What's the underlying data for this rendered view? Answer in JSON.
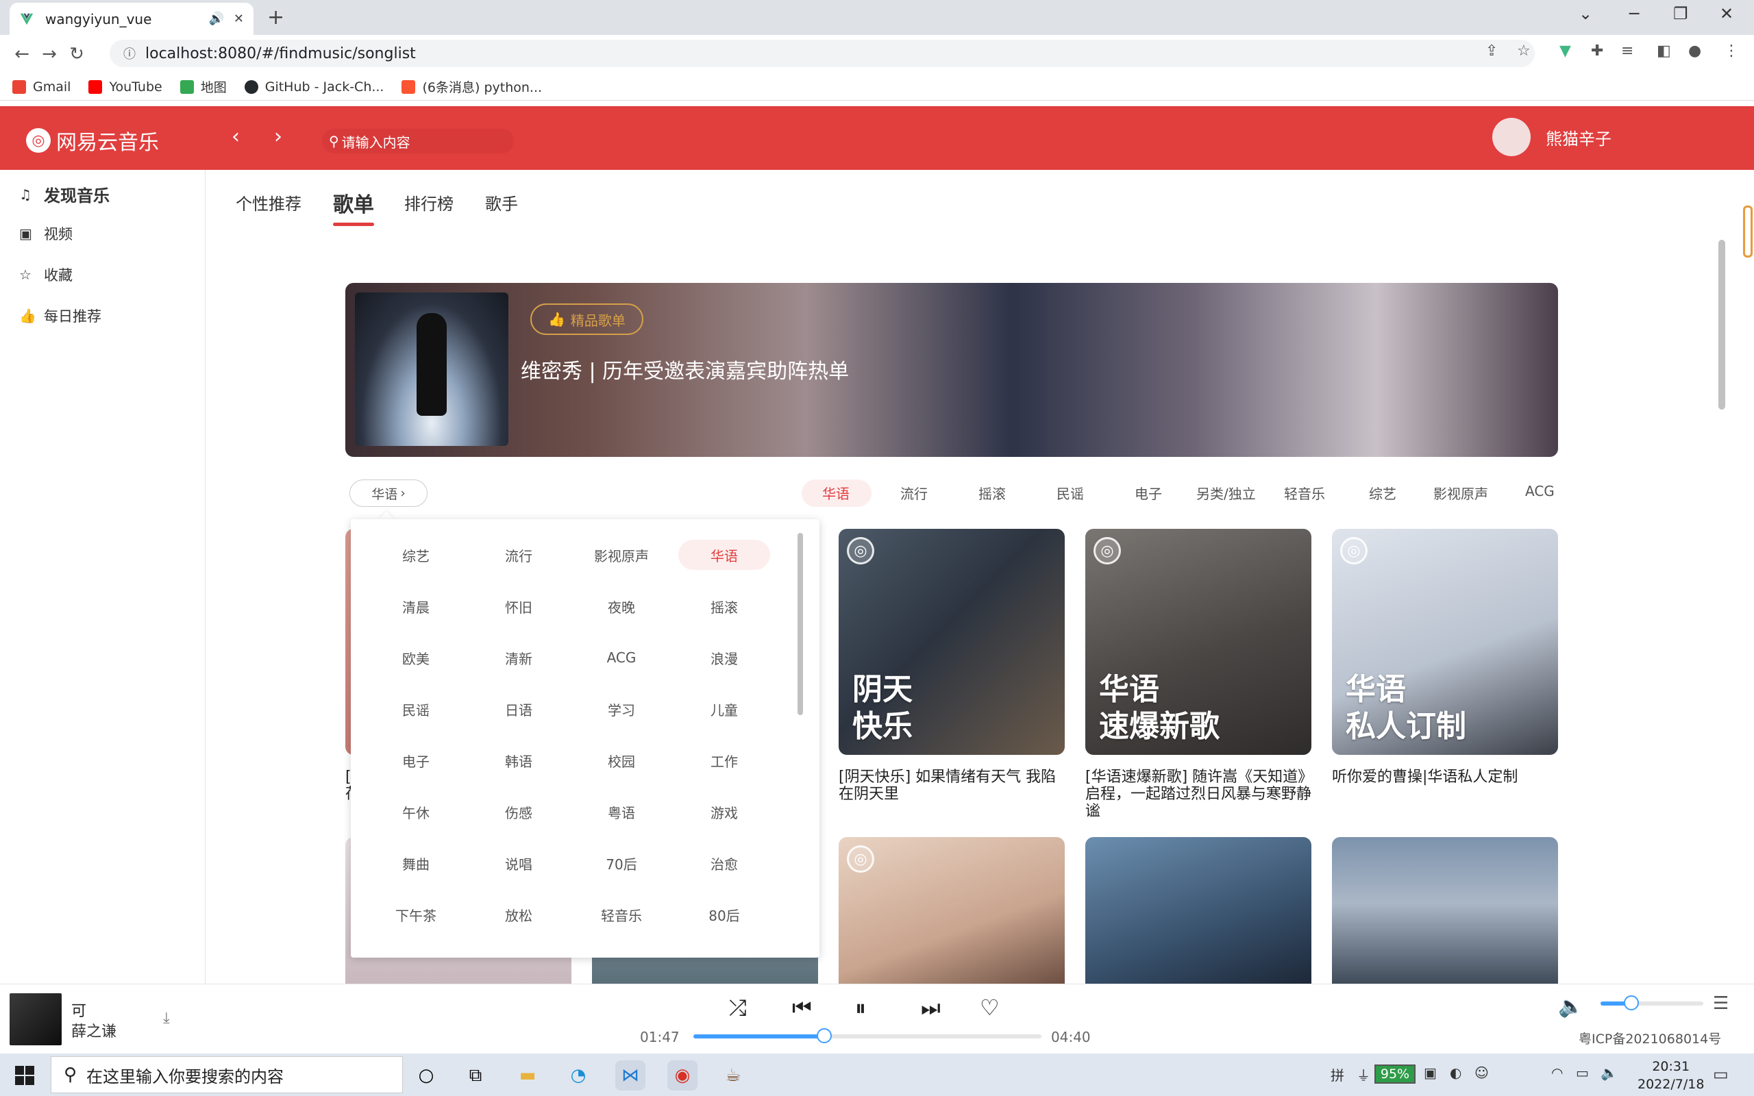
{
  "browser": {
    "tab_title": "wangyiyun_vue",
    "url": "localhost:8080/#/findmusic/songlist",
    "bookmarks": [
      {
        "label": "Gmail",
        "color": "#ea4335"
      },
      {
        "label": "YouTube",
        "color": "#ff0000"
      },
      {
        "label": "地图",
        "color": "#34a853"
      },
      {
        "label": "GitHub - Jack-Ch...",
        "color": "#24292e"
      },
      {
        "label": "(6条消息) python...",
        "color": "#fc5531"
      }
    ]
  },
  "app": {
    "logo_text": "网易云音乐",
    "search_placeholder": "请输入内容",
    "username": "熊猫辛子",
    "brand_color": "#e13e3e"
  },
  "sidebar": {
    "items": [
      {
        "label": "发现音乐",
        "icon": "music-note-icon"
      },
      {
        "label": "视频",
        "icon": "video-icon"
      },
      {
        "label": "收藏",
        "icon": "star-icon"
      },
      {
        "label": "每日推荐",
        "icon": "thumbs-up-icon"
      }
    ]
  },
  "tabs": [
    "个性推荐",
    "歌单",
    "排行榜",
    "歌手"
  ],
  "banner": {
    "tag": "精品歌单",
    "title": "维密秀 | 历年受邀表演嘉宾助阵热单"
  },
  "category_button": "华语",
  "categories": [
    "华语",
    "流行",
    "摇滚",
    "民谣",
    "电子",
    "另类/独立",
    "轻音乐",
    "综艺",
    "影视原声",
    "ACG"
  ],
  "popup": {
    "items": [
      "综艺",
      "流行",
      "影视原声",
      "华语",
      "清晨",
      "怀旧",
      "夜晚",
      "摇滚",
      "欧美",
      "清新",
      "ACG",
      "浪漫",
      "民谣",
      "日语",
      "学习",
      "儿童",
      "电子",
      "韩语",
      "校园",
      "工作",
      "午休",
      "伤感",
      "粤语",
      "游戏",
      "舞曲",
      "说唱",
      "70后",
      "治愈",
      "下午茶",
      "放松",
      "轻音乐",
      "80后"
    ],
    "selected": "华语"
  },
  "cards": [
    {
      "overlay1": "阴天",
      "overlay2": "快乐",
      "title": "[阴天快乐] 如果情绪有天气 我陷在阴天里"
    },
    {
      "overlay1": "华语",
      "overlay2": "速爆新歌",
      "title": "[华语速爆新歌] 随许嵩《天知道》启程，一起踏过烈日风暴与寒野静谧"
    },
    {
      "overlay1": "华语",
      "overlay2": "私人订制",
      "title": "听你爱的曹操|华语私人定制"
    }
  ],
  "partial_card_title": "[\n荷",
  "player": {
    "song": "可",
    "artist": "薛之谦",
    "current_time": "01:47",
    "total_time": "04:40",
    "progress": 0.38,
    "volume": 0.3,
    "icp": "粤ICP备2021068014号"
  },
  "taskbar": {
    "search_placeholder": "在这里输入你要搜索的内容",
    "battery": "95%",
    "time": "20:31",
    "date": "2022/7/18"
  }
}
